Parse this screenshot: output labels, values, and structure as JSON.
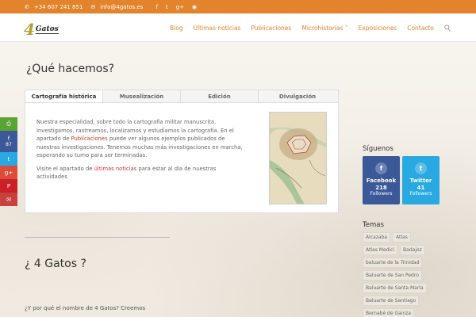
{
  "topbar": {
    "phone": "+34 607 241 851",
    "email": "info@4gatos.es",
    "social_icons": [
      "facebook-icon",
      "twitter-icon",
      "google-plus-icon",
      "rss-icon"
    ]
  },
  "logo": {
    "number": "4",
    "word": "Gatos"
  },
  "nav": {
    "items": [
      "Blog",
      "Últimas noticias",
      "Publicaciones",
      "Microhistorias",
      "Exposiciones",
      "Contacto"
    ],
    "dropdown_marker": "˅",
    "search_icon": "search-icon"
  },
  "main": {
    "title": "¿Qué hacemos?",
    "tabs": [
      "Cartografía histórica",
      "Musealización",
      "Edición",
      "Divulgación"
    ],
    "active_tab": 0,
    "paragraph1_a": "Nuestra especialidad, sobre todo la cartografía militar manuscrita. Investigamos, rastreamos, localizamos y estudiamos la cartografía. En el apartado de ",
    "paragraph1_link": "Publicaciones",
    "paragraph1_b": " puede ver algunos ejemplos publicados de nuestras investigaciones. Tenemos muchas más investigaciones en marcha, esperando su turno para ser terminadas.",
    "paragraph2_a": "Visite el apartado de ",
    "paragraph2_link": "últimas noticias",
    "paragraph2_b": " para estar al día de nuestras actividades",
    "subtitle": "¿ 4 Gatos ?",
    "why_text": "¿Y por qué el nombre de 4 Gatos? Creemos"
  },
  "sidebar": {
    "follow_title": "Síguenos",
    "facebook": {
      "name": "Facebook",
      "count": "218",
      "unit": "Followers"
    },
    "twitter": {
      "name": "Twitter",
      "count": "41",
      "unit": "Followers"
    },
    "tags_title": "Temas",
    "tags": [
      "Alcazaba",
      "Atlas",
      "Atlas Medici",
      "Badajoz",
      "baluarte de la Trinidad",
      "Baluarte de San Pedro",
      "Baluarte de Santa María",
      "Baluarte de Santiago",
      "Bernabé de Gainza"
    ]
  },
  "share": {
    "facebook_count": "87",
    "buttons": [
      "print-icon",
      "facebook-icon",
      "twitter-icon",
      "google-plus-icon",
      "pinterest-icon",
      "email-icon"
    ]
  },
  "colors": {
    "accent": "#e3832b",
    "link": "#c0392b",
    "facebook": "#3b5998",
    "twitter": "#29a9e1"
  }
}
